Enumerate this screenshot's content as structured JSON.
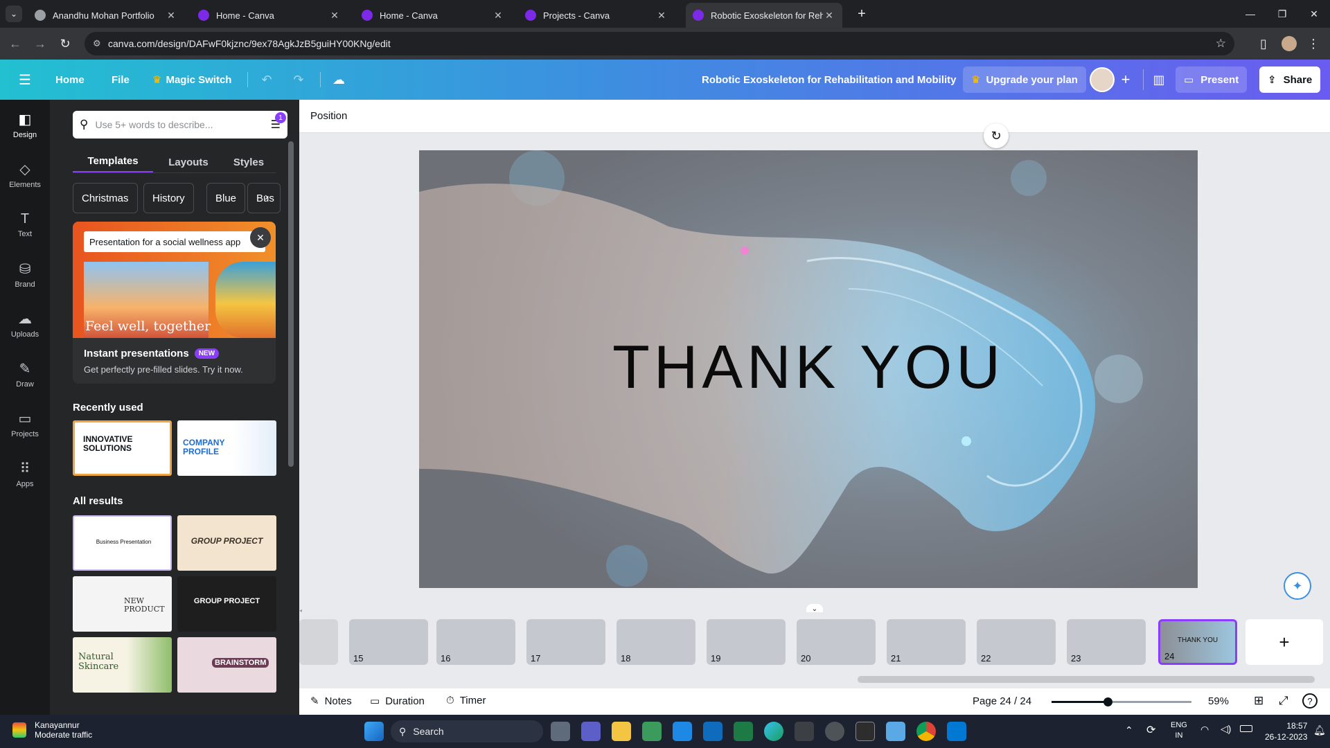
{
  "browser": {
    "tabs": [
      {
        "title": "Anandhu Mohan Portfolio",
        "active": false
      },
      {
        "title": "Home - Canva",
        "active": false
      },
      {
        "title": "Home - Canva",
        "active": false
      },
      {
        "title": "Projects - Canva",
        "active": false
      },
      {
        "title": "Robotic Exoskeleton for Rehabil",
        "active": true
      }
    ],
    "url": "canva.com/design/DAFwF0kjznc/9ex78AgkJzB5guiHY00KNg/edit"
  },
  "header": {
    "home": "Home",
    "file": "File",
    "magic_switch": "Magic Switch",
    "doc_title": "Robotic Exoskeleton for Rehabilitation and Mobility",
    "upgrade": "Upgrade your plan",
    "present": "Present",
    "share": "Share"
  },
  "rail": [
    {
      "label": "Design",
      "icon": "layout-icon"
    },
    {
      "label": "Elements",
      "icon": "shapes-icon"
    },
    {
      "label": "Text",
      "icon": "text-icon"
    },
    {
      "label": "Brand",
      "icon": "brand-icon"
    },
    {
      "label": "Uploads",
      "icon": "upload-icon"
    },
    {
      "label": "Draw",
      "icon": "pen-icon"
    },
    {
      "label": "Projects",
      "icon": "folder-icon"
    },
    {
      "label": "Apps",
      "icon": "grid-icon"
    }
  ],
  "panel": {
    "search_placeholder": "Use 5+ words to describe...",
    "filter_badge": "1",
    "tabs": [
      "Templates",
      "Layouts",
      "Styles"
    ],
    "chips": [
      "Christmas",
      "History",
      "Blue",
      "Bus"
    ],
    "promo": {
      "prompt": "Presentation for a social wellness app",
      "image_caption": "Feel well, together",
      "title": "Instant presentations",
      "badge": "NEW",
      "subtitle": "Get perfectly pre-filled slides. Try it now."
    },
    "recently_used_title": "Recently used",
    "recently_used": [
      "INNOVATIVE SOLUTIONS",
      "COMPANY PROFILE"
    ],
    "all_results_title": "All results",
    "all_results": [
      "Business Presentation",
      "GROUP PROJECT",
      "NEW PRODUCT",
      "GROUP PROJECT",
      "Natural Skincare",
      "BRAINSTORM"
    ]
  },
  "editor": {
    "context_label": "Position",
    "slide_text": "THANK YOU"
  },
  "filmstrip": {
    "pages": [
      "15",
      "16",
      "17",
      "18",
      "19",
      "20",
      "21",
      "22",
      "23",
      "24"
    ],
    "selected": "24",
    "selected_thumb_text": "THANK YOU"
  },
  "footer": {
    "notes": "Notes",
    "duration": "Duration",
    "timer": "Timer",
    "page_indicator": "Page 24 / 24",
    "zoom": "59%",
    "zoom_level": 0.59
  },
  "taskbar": {
    "weather_location": "Kanayannur",
    "weather_status": "Moderate traffic",
    "search": "Search",
    "lang_top": "ENG",
    "lang_bottom": "IN",
    "time": "18:57",
    "date": "26-12-2023"
  }
}
